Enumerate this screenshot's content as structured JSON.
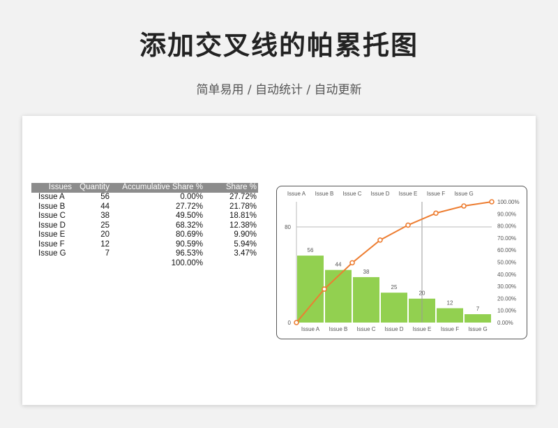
{
  "header": {
    "title": "添加交叉线的帕累托图",
    "subtitle": "简单易用 / 自动统计 / 自动更新"
  },
  "table": {
    "columns": [
      "Issues",
      "Quantity",
      "Accumulative Share %",
      "Share %"
    ],
    "rows": [
      [
        "Issue A",
        "56",
        "0.00%",
        "27.72%"
      ],
      [
        "Issue B",
        "44",
        "27.72%",
        "21.78%"
      ],
      [
        "Issue C",
        "38",
        "49.50%",
        "18.81%"
      ],
      [
        "Issue D",
        "25",
        "68.32%",
        "12.38%"
      ],
      [
        "Issue E",
        "20",
        "80.69%",
        "9.90%"
      ],
      [
        "Issue F",
        "12",
        "90.59%",
        "5.94%"
      ],
      [
        "Issue G",
        "7",
        "96.53%",
        "3.47%"
      ]
    ],
    "total_accumulative": "100.00%"
  },
  "chart_data": {
    "type": "bar",
    "categories": [
      "Issue A",
      "Issue B",
      "Issue C",
      "Issue D",
      "Issue E",
      "Issue F",
      "Issue G"
    ],
    "series": [
      {
        "type": "bar",
        "values": [
          56,
          44,
          38,
          25,
          20,
          12,
          7
        ],
        "color": "#92d050"
      },
      {
        "type": "line",
        "axis": "secondary",
        "x": [
          0,
          1,
          2,
          3,
          4,
          5,
          6,
          7
        ],
        "values": [
          0,
          27.72,
          49.5,
          68.32,
          80.69,
          90.59,
          96.53,
          100.0
        ],
        "color": "#ed7d31"
      }
    ],
    "primary_axis": {
      "range": [
        0,
        101
      ],
      "ticks": [
        0,
        80
      ]
    },
    "secondary_axis": {
      "range": [
        0,
        100
      ],
      "ticks": [
        0,
        10,
        20,
        30,
        40,
        50,
        60,
        70,
        80,
        90,
        100
      ],
      "tick_labels": [
        "0.00%",
        "10.00%",
        "20.00%",
        "30.00%",
        "40.00%",
        "50.00%",
        "60.00%",
        "70.00%",
        "80.00%",
        "90.00%",
        "100.00%"
      ]
    },
    "crosshair": {
      "category_index": 4,
      "y_value": 80
    },
    "grid": false,
    "top_category_labels": true
  }
}
